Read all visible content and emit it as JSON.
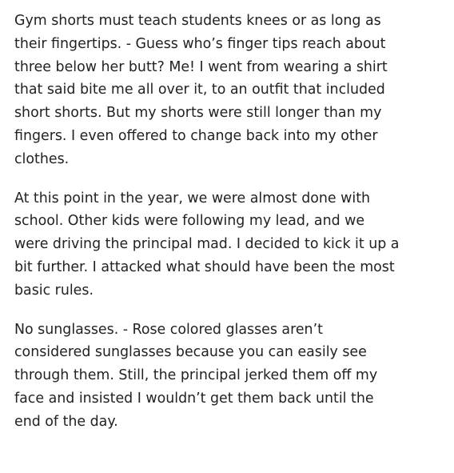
{
  "paragraphs": [
    {
      "lines": [
        "Gym shorts must teach students knees or as long as",
        "their fingertips. - Guess who’s finger tips reach about",
        "three below her butt? Me! I went from wearing a shirt",
        "that said bite me all over it, to an outfit that included",
        "short shorts. But my shorts were still longer than my",
        "fingers. I even offered to change back into my other",
        "clothes."
      ]
    },
    {
      "lines": [
        "At this point in the year, we were almost done with",
        "school. Other kids were following my lead, and we",
        "were driving the principal mad. I decided to kick it up a",
        "bit further. I attacked what should have been the most",
        "basic rules."
      ]
    },
    {
      "lines": [
        "No sunglasses. - Rose colored glasses aren’t",
        "considered sunglasses because you can easily see",
        "through them. Still, the principal jerked them off my",
        "face and insisted I wouldn’t get them back until the",
        "end of the day."
      ]
    }
  ]
}
